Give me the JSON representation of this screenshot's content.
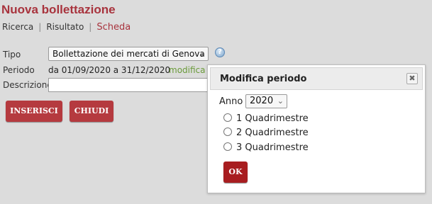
{
  "page": {
    "title": "Nuova bollettazione"
  },
  "tabs": [
    {
      "label": "Ricerca"
    },
    {
      "label": "Risultato"
    },
    {
      "label": "Scheda"
    }
  ],
  "tab_separator": "|",
  "form": {
    "tipo_label": "Tipo",
    "tipo_value": "Bollettazione dei mercati di Genova",
    "periodo_label": "Periodo",
    "periodo_value": "da 01/09/2020 a 31/12/2020",
    "periodo_link": "modifica",
    "descrizione_label": "Descrizione",
    "descrizione_value": ""
  },
  "buttons": {
    "inserisci": "INSERISCI",
    "chiudi": "CHIUDI"
  },
  "help_glyph": "?",
  "modal": {
    "title": "Modifica periodo",
    "close_glyph": "✖",
    "anno_label": "Anno",
    "anno_value": "2020",
    "options": [
      {
        "label": "1 Quadrimestre"
      },
      {
        "label": "2 Quadrimestre"
      },
      {
        "label": "3 Quadrimestre"
      }
    ],
    "ok_label": "OK"
  },
  "chevron_glyph": "⌄",
  "icons": [
    "help-icon",
    "close-icon",
    "chevron-down-icon"
  ],
  "colors": {
    "accent": "#a8333d",
    "button": "#b53a3f",
    "link": "#6a9a3a",
    "background": "#dcdcdc"
  }
}
